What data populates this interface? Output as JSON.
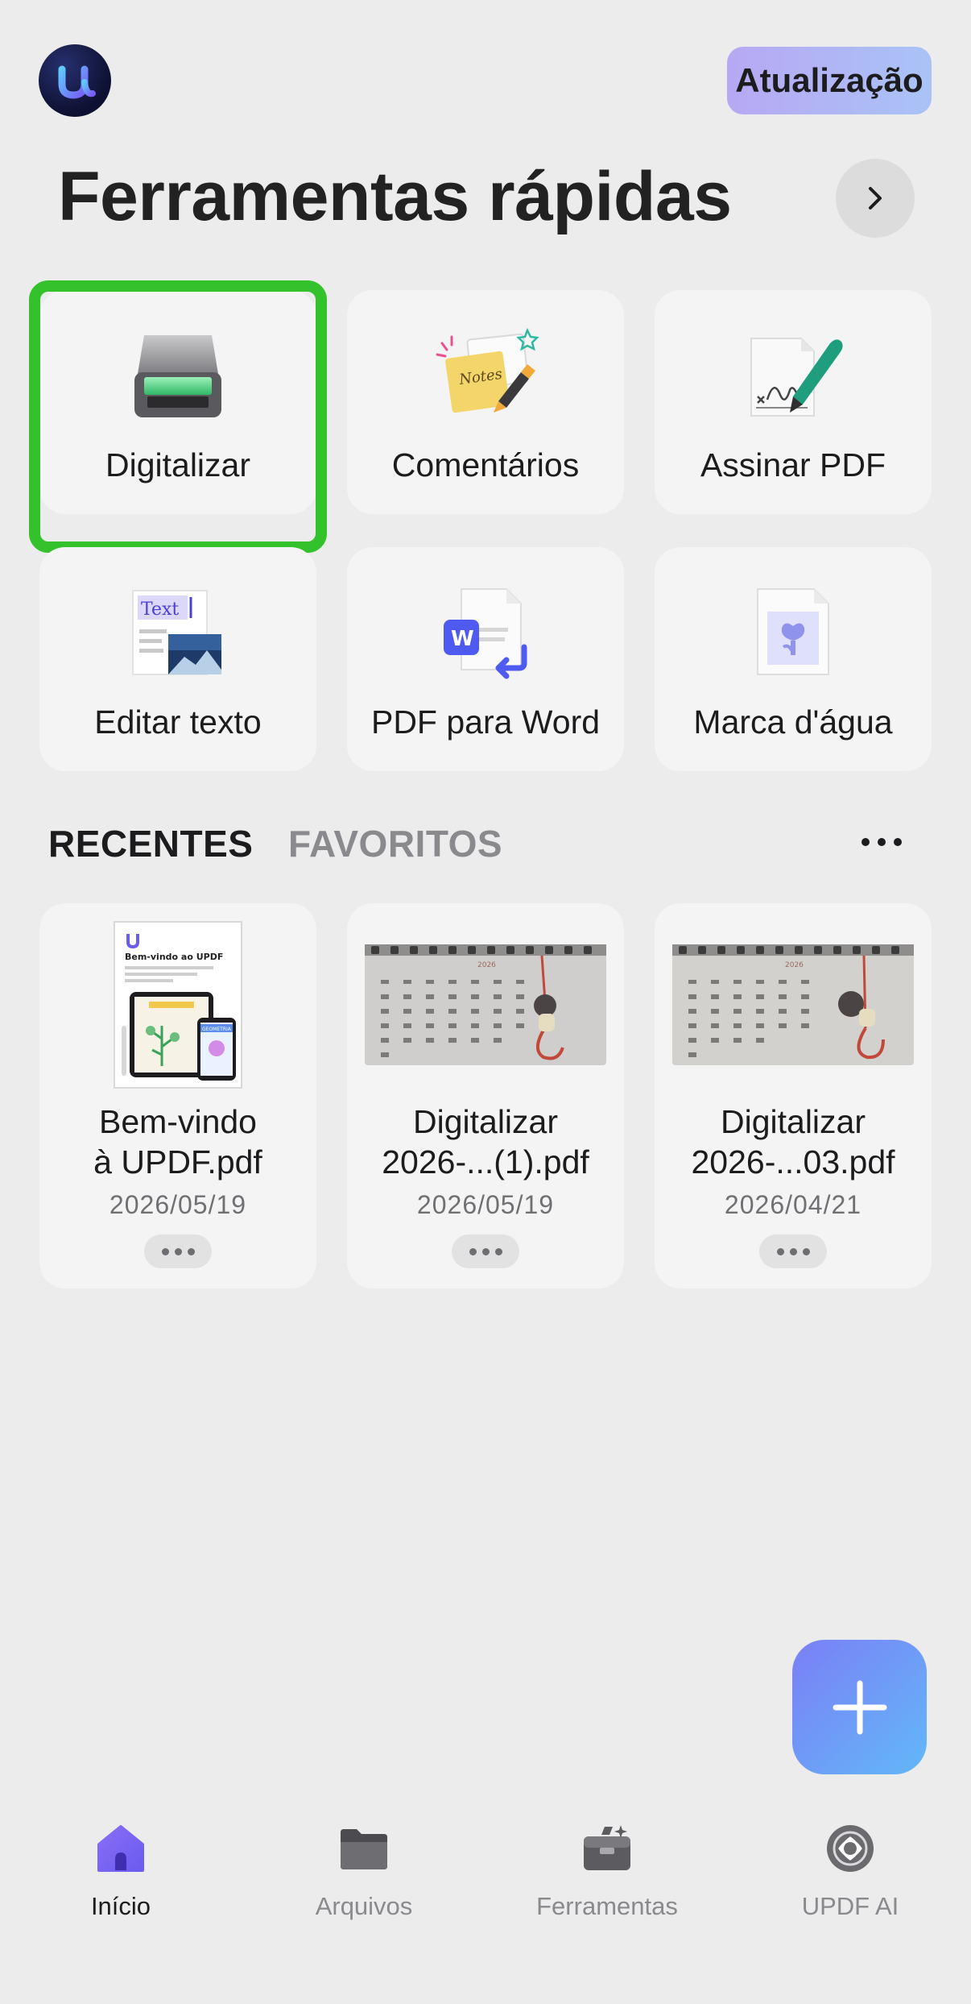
{
  "header": {
    "logo_icon": "updf-logo-icon",
    "upgrade_label": "Atualização",
    "title": "Ferramentas rápidas"
  },
  "tools": [
    {
      "label": "Digitalizar",
      "icon": "scanner-icon"
    },
    {
      "label": "Comentários",
      "icon": "sticky-notes-icon"
    },
    {
      "label": "Assinar PDF",
      "icon": "signature-pen-icon"
    },
    {
      "label": "Editar texto",
      "icon": "edit-text-icon"
    },
    {
      "label": "PDF para Word",
      "icon": "pdf-to-word-icon"
    },
    {
      "label": "Marca d'água",
      "icon": "watermark-icon"
    }
  ],
  "tabs": {
    "recent": "RECENTES",
    "favorites": "FAVORITOS"
  },
  "recent_files": [
    {
      "name_line1": "Bem-vindo",
      "name_line2": "à UPDF.pdf",
      "date": "2026/05/19"
    },
    {
      "name_line1": "Digitalizar",
      "name_line2": "2026-...(1).pdf",
      "date": "2026/05/19"
    },
    {
      "name_line1": "Digitalizar",
      "name_line2": "2026-...03.pdf",
      "date": "2026/04/21"
    }
  ],
  "thumb_text": {
    "welcome_title": "Bem-vindo ao UPDF",
    "welcome_badge": "GEOMETRIA",
    "calendar_year": "2026",
    "notes_word": "Notes",
    "text_word": "Text",
    "word_letter": "W"
  },
  "nav": [
    {
      "label": "Início",
      "icon": "home-icon",
      "active": true
    },
    {
      "label": "Arquivos",
      "icon": "folder-icon",
      "active": false
    },
    {
      "label": "Ferramentas",
      "icon": "toolbox-icon",
      "active": false
    },
    {
      "label": "UPDF AI",
      "icon": "ai-icon",
      "active": false
    }
  ],
  "colors": {
    "background": "#ececec",
    "highlight": "#33c12c",
    "active_nav": "#1c1c1e",
    "inactive_nav": "#8a8a8e",
    "accent": "#7b6cf0"
  }
}
